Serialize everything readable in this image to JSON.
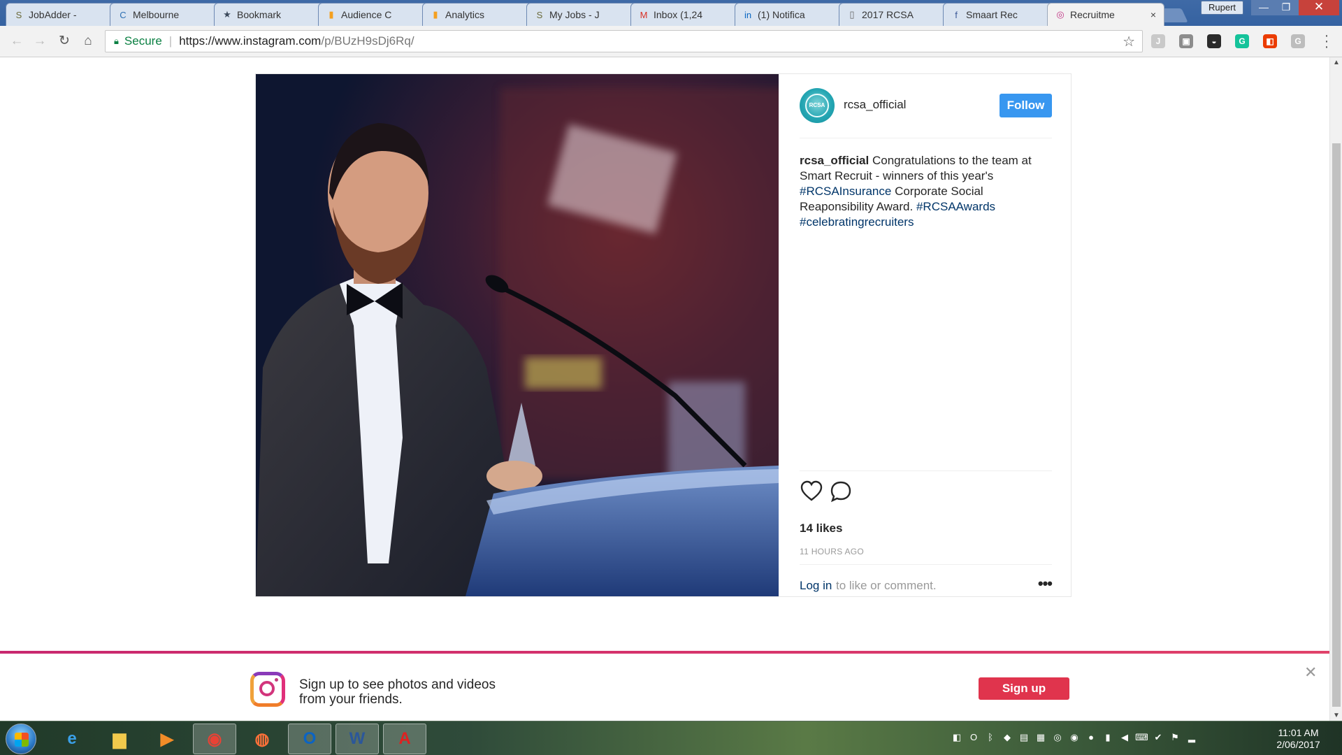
{
  "browser": {
    "tabs": [
      {
        "label": "JobAdder -",
        "icon": "jobadder-icon",
        "glyph": "S",
        "color": "#6b6b3a"
      },
      {
        "label": "Melbourne",
        "icon": "c-app-icon",
        "glyph": "C",
        "color": "#2d6fb3"
      },
      {
        "label": "Bookmark",
        "icon": "star-icon",
        "glyph": "★",
        "color": "#3c4a5c"
      },
      {
        "label": "Audience C",
        "icon": "analytics-icon",
        "glyph": "▮",
        "color": "#f4a020"
      },
      {
        "label": "Analytics",
        "icon": "analytics-icon",
        "glyph": "▮",
        "color": "#f4a020"
      },
      {
        "label": "My Jobs - J",
        "icon": "jobadder-icon",
        "glyph": "S",
        "color": "#6b6b3a"
      },
      {
        "label": "Inbox (1,24",
        "icon": "gmail-icon",
        "glyph": "M",
        "color": "#d93025"
      },
      {
        "label": "(1) Notifica",
        "icon": "linkedin-icon",
        "glyph": "in",
        "color": "#0a66c2"
      },
      {
        "label": "2017 RCSA",
        "icon": "document-icon",
        "glyph": "▯",
        "color": "#666666"
      },
      {
        "label": "Smaart Rec",
        "icon": "facebook-icon",
        "glyph": "f",
        "color": "#3b5998"
      },
      {
        "label": "Recruitme",
        "icon": "instagram-icon",
        "glyph": "◎",
        "color": "#c13584"
      }
    ],
    "active_tab_index": 10,
    "profile_name": "Rupert",
    "address": {
      "secure_label": "Secure",
      "url_host": "https://www.instagram.com",
      "url_path": "/p/BUzH9sDj6Rq/"
    },
    "extensions": [
      {
        "name": "j-extension-icon",
        "glyph": "J",
        "color": "#c9c9c9"
      },
      {
        "name": "notes-extension-icon",
        "glyph": "▣",
        "color": "#8c8c8c"
      },
      {
        "name": "mask-extension-icon",
        "glyph": "◒",
        "color": "#2b2b2b"
      },
      {
        "name": "grammarly-icon",
        "glyph": "G",
        "color": "#15c39a"
      },
      {
        "name": "office-icon",
        "glyph": "◧",
        "color": "#eb3c00"
      },
      {
        "name": "g-extension-icon",
        "glyph": "G",
        "color": "#bdbdbd"
      }
    ]
  },
  "post": {
    "username": "rcsa_official",
    "avatar_text": "RCSA",
    "follow_label": "Follow",
    "caption_user": "rcsa_official",
    "caption_text": "Congratulations to the team at Smart Recruit - winners of this year's",
    "tag1": "#RCSAInsurance",
    "caption_text2": "Corporate Social Reaponsibility Award.",
    "tag2": "#RCSAAwards",
    "tag3": "#celebratingrecruiters",
    "likes": "14 likes",
    "time_ago": "11 HOURS AGO",
    "login_label": "Log in",
    "login_rest": "to like or comment.",
    "more_label": "•••"
  },
  "banner": {
    "line1": "Sign up to see photos and videos",
    "line2": "from your friends.",
    "signup_label": "Sign up",
    "close_label": "✕"
  },
  "taskbar": {
    "apps": [
      {
        "name": "internet-explorer-icon",
        "glyph": "e",
        "color": "#3aa0e8",
        "active": false
      },
      {
        "name": "file-explorer-icon",
        "glyph": "▆",
        "color": "#f2c94c",
        "active": false
      },
      {
        "name": "media-player-icon",
        "glyph": "▶",
        "color": "#f28c28",
        "active": false
      },
      {
        "name": "chrome-icon",
        "glyph": "◉",
        "color": "#e94235",
        "active": true
      },
      {
        "name": "firefox-icon",
        "glyph": "◍",
        "color": "#ff7139",
        "active": false
      },
      {
        "name": "outlook-icon",
        "glyph": "O",
        "color": "#0b64c4",
        "active": true
      },
      {
        "name": "word-icon",
        "glyph": "W",
        "color": "#2b579a",
        "active": true
      },
      {
        "name": "acrobat-icon",
        "glyph": "A",
        "color": "#e02020",
        "active": true
      }
    ],
    "tray_icons": [
      "office-tray-icon",
      "outlook-tray-icon",
      "bluetooth-icon",
      "dropbox-icon",
      "network-drive-icon",
      "printer-icon",
      "webcam-icon",
      "chrome-tray-icon",
      "recorder-icon",
      "battery-icon",
      "volume-icon",
      "keyboard-icon",
      "security-icon",
      "flag-icon",
      "signal-icon"
    ],
    "time": "11:01 AM",
    "date": "2/06/2017"
  }
}
